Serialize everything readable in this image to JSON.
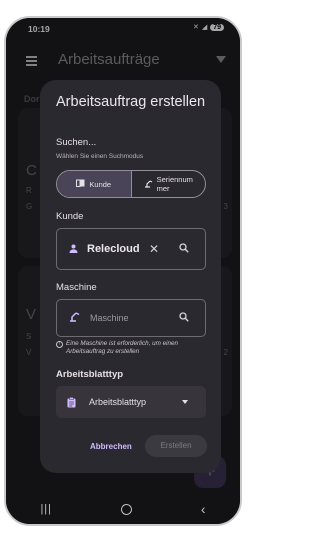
{
  "status_bar": {
    "time": "10:19",
    "battery": "79"
  },
  "app_bar": {
    "title": "Arbeitsaufträge"
  },
  "background": {
    "section_label": "Dor",
    "card1_big": "C",
    "card1_line1": "R",
    "card1_line2": "G",
    "card1_right": "3",
    "card2_big": "V",
    "card2_line1": "S",
    "card2_line2": "V",
    "card2_right": "2",
    "fab_label": "+"
  },
  "dialog": {
    "title": "Arbeitsauftrag erstellen",
    "search_label": "Suchen...",
    "search_sub": "Wählen Sie einen Suchmodus",
    "segment_kunde": "Kunde",
    "segment_serial_line1": "Seriennum",
    "segment_serial_line2": "mer",
    "kunde_label": "Kunde",
    "kunde_value": "Relecloud",
    "maschine_label": "Maschine",
    "maschine_placeholder": "Maschine",
    "maschine_hint": "Eine Maschine ist erforderlich, um einen Arbeitsauftrag zu erstellen",
    "worksheet_label": "Arbeitsblatttyp",
    "worksheet_value": "Arbeitsblatttyp",
    "cancel_label": "Abbrechen",
    "create_label": "Erstellen"
  },
  "colors": {
    "accent": "#cfbcff",
    "dialog_bg": "#2b2930",
    "screen_bg": "#1c1b1f"
  }
}
